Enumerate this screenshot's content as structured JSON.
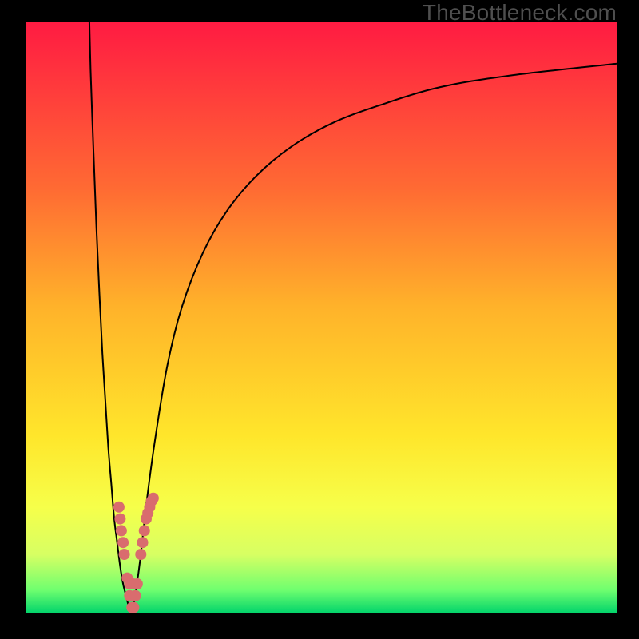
{
  "watermark": "TheBottleneck.com",
  "chart_data": {
    "type": "line",
    "title": "",
    "xlabel": "",
    "ylabel": "",
    "xlim": [
      0,
      100
    ],
    "ylim": [
      0,
      100
    ],
    "grid": false,
    "series": [
      {
        "name": "left-branch",
        "style": "curve",
        "x": [
          10.8,
          11.0,
          11.5,
          12.0,
          12.5,
          13.0,
          13.5,
          14.0,
          14.5,
          15.0,
          15.5,
          16.0,
          16.5,
          17.0,
          17.5,
          18.0
        ],
        "y": [
          100,
          92,
          78,
          65,
          54,
          44,
          36,
          28,
          22,
          16,
          12,
          8,
          5,
          3,
          1,
          0
        ]
      },
      {
        "name": "right-branch",
        "style": "curve",
        "x": [
          18.0,
          18.7,
          19.5,
          20.5,
          22.0,
          24.0,
          26.5,
          30.0,
          34.0,
          39.0,
          45.0,
          52.0,
          60.0,
          70.0,
          82.0,
          100.0
        ],
        "y": [
          0,
          4,
          10,
          19,
          30,
          42,
          52,
          61,
          68,
          74,
          79,
          83,
          86,
          89,
          91,
          93
        ]
      },
      {
        "name": "left-highlight",
        "style": "dots",
        "x": [
          15.8,
          16.0,
          16.2,
          16.5,
          16.7,
          17.2,
          17.6,
          18.0
        ],
        "y": [
          18,
          16,
          14,
          12,
          10,
          6,
          3,
          1
        ]
      },
      {
        "name": "right-highlight",
        "style": "dots",
        "x": [
          18.3,
          18.6,
          18.9,
          19.5,
          19.8,
          20.1,
          20.4,
          20.7,
          21.0,
          21.3,
          21.6
        ],
        "y": [
          1,
          3,
          5,
          10,
          12,
          14,
          16,
          17,
          18,
          19,
          19.5
        ]
      },
      {
        "name": "mid-highlight",
        "style": "dots",
        "x": [
          17.6,
          18.2
        ],
        "y": [
          5,
          5
        ]
      }
    ],
    "background": {
      "type": "vertical-gradient",
      "stops": [
        {
          "pos": 0.0,
          "color": "#ff1b42"
        },
        {
          "pos": 0.28,
          "color": "#ff6a33"
        },
        {
          "pos": 0.48,
          "color": "#ffb22a"
        },
        {
          "pos": 0.7,
          "color": "#ffe62b"
        },
        {
          "pos": 0.82,
          "color": "#f6ff4a"
        },
        {
          "pos": 0.9,
          "color": "#d7ff63"
        },
        {
          "pos": 0.96,
          "color": "#70ff6f"
        },
        {
          "pos": 1.0,
          "color": "#00d36b"
        }
      ]
    },
    "colors": {
      "curve": "#000000",
      "dots": "#d96c6e"
    }
  }
}
